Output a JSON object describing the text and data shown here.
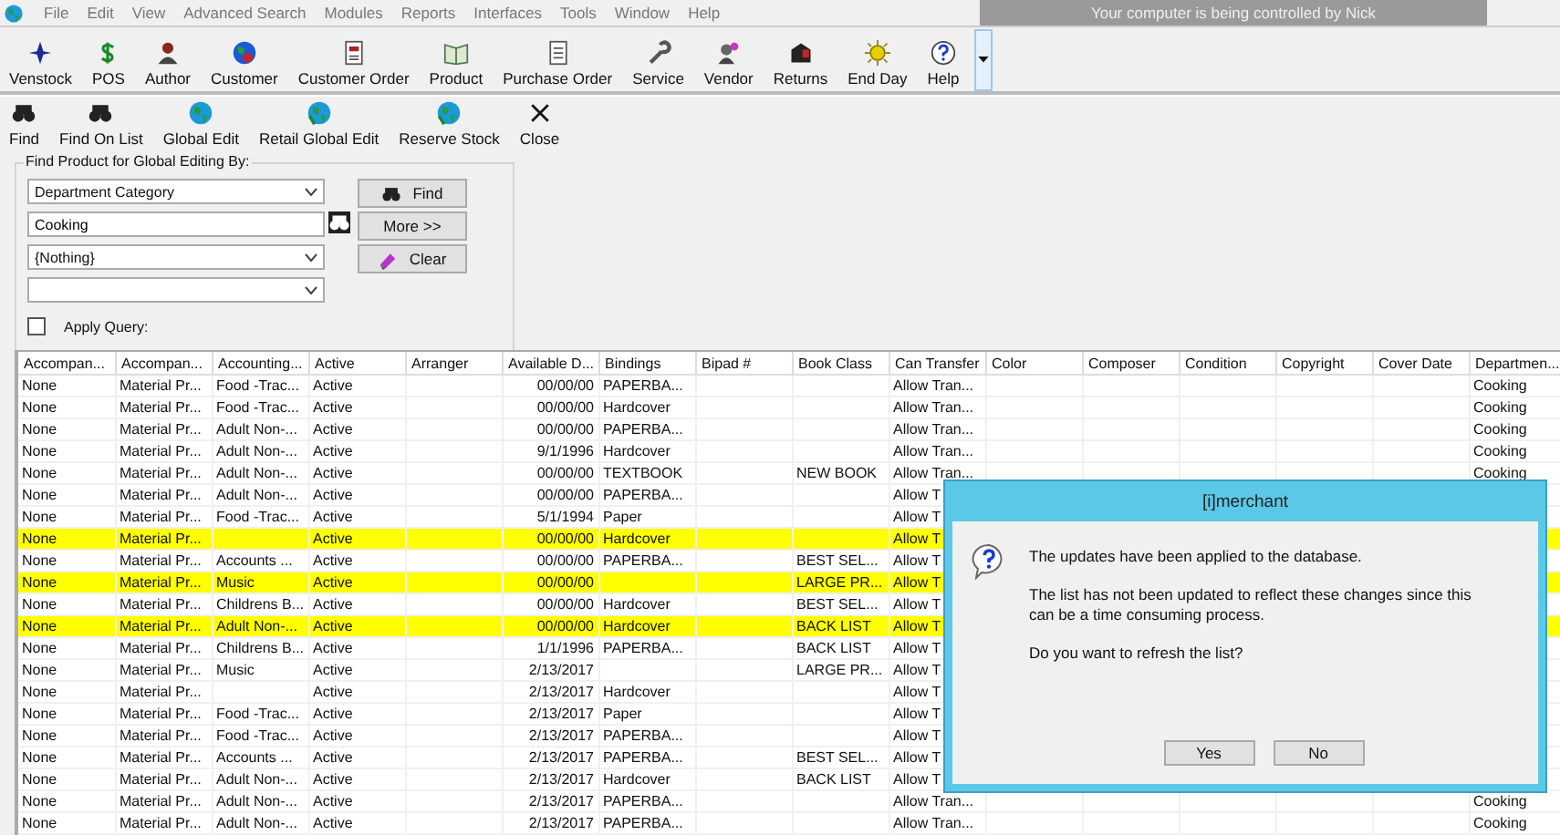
{
  "menu": [
    "File",
    "Edit",
    "View",
    "Advanced Search",
    "Modules",
    "Reports",
    "Interfaces",
    "Tools",
    "Window",
    "Help"
  ],
  "banner": {
    "text": "Your computer is being controlled by Nick"
  },
  "main_toolbar": [
    "Venstock",
    "POS",
    "Author",
    "Customer",
    "Customer Order",
    "Product",
    "Purchase Order",
    "Service",
    "Vendor",
    "Returns",
    "End Day",
    "Help"
  ],
  "sub_toolbar": [
    "Find",
    "Find On List",
    "Global Edit",
    "Retail Global Edit",
    "Reserve Stock",
    "Close"
  ],
  "find_panel": {
    "title": "Find Product for Global Editing By:",
    "field_1": "Department Category",
    "search_value": "Cooking",
    "field_2": "{Nothing}",
    "apply_query": {
      "label": "Apply Query:",
      "checked": false
    },
    "buttons": [
      "Find",
      "More >>",
      "Clear"
    ]
  },
  "table": {
    "columns": [
      "Accompan...",
      "Accompan...",
      "Accounting...",
      "Active",
      "Arranger",
      "Available D...",
      "Bindings",
      "Bipad #",
      "Book Class",
      "Can Transfer",
      "Color",
      "Composer",
      "Condition",
      "Copyright",
      "Cover Date",
      "Departmen..."
    ],
    "rows": [
      {
        "highlighted": false,
        "cells": {
          "column_1": "None",
          "column_2": "Material Pr...",
          "column_3": "Food -Trac...",
          "column_4": "Active",
          "column_6": "00/00/00",
          "column_7": "PAPERBA...",
          "column_10": "Allow Tran...",
          "column_16": "Cooking"
        }
      },
      {
        "highlighted": false,
        "cells": {
          "column_1": "None",
          "column_2": "Material Pr...",
          "column_3": "Food -Trac...",
          "column_4": "Active",
          "column_6": "00/00/00",
          "column_7": "Hardcover",
          "column_10": "Allow Tran...",
          "column_16": "Cooking"
        }
      },
      {
        "highlighted": false,
        "cells": {
          "column_1": "None",
          "column_2": "Material Pr...",
          "column_3": "Adult Non-...",
          "column_4": "Active",
          "column_6": "00/00/00",
          "column_7": "PAPERBA...",
          "column_10": "Allow Tran...",
          "column_16": "Cooking"
        }
      },
      {
        "highlighted": false,
        "cells": {
          "column_1": "None",
          "column_2": "Material Pr...",
          "column_3": "Adult Non-...",
          "column_4": "Active",
          "column_6": "9/1/1996",
          "column_7": "Hardcover",
          "column_10": "Allow Tran...",
          "column_16": "Cooking"
        }
      },
      {
        "highlighted": false,
        "cells": {
          "column_1": "None",
          "column_2": "Material Pr...",
          "column_3": "Adult Non-...",
          "column_4": "Active",
          "column_6": "00/00/00",
          "column_7": "TEXTBOOK",
          "column_9": "NEW BOOK",
          "column_10": "Allow Tran...",
          "column_16": "Cooking"
        }
      },
      {
        "highlighted": false,
        "cells": {
          "column_1": "None",
          "column_2": "Material Pr...",
          "column_3": "Adult Non-...",
          "column_4": "Active",
          "column_6": "00/00/00",
          "column_7": "PAPERBA...",
          "column_10": "Allow T"
        }
      },
      {
        "highlighted": false,
        "cells": {
          "column_1": "None",
          "column_2": "Material Pr...",
          "column_3": "Food -Trac...",
          "column_4": "Active",
          "column_6": "5/1/1994",
          "column_7": "Paper",
          "column_10": "Allow T"
        }
      },
      {
        "highlighted": true,
        "cells": {
          "column_1": "None",
          "column_2": "Material Pr...",
          "column_4": "Active",
          "column_6": "00/00/00",
          "column_7": "Hardcover",
          "column_10": "Allow T"
        }
      },
      {
        "highlighted": false,
        "cells": {
          "column_1": "None",
          "column_2": "Material Pr...",
          "column_3": "Accounts ...",
          "column_4": "Active",
          "column_6": "00/00/00",
          "column_7": "PAPERBA...",
          "column_9": "BEST SEL...",
          "column_10": "Allow T"
        }
      },
      {
        "highlighted": true,
        "cells": {
          "column_1": "None",
          "column_2": "Material Pr...",
          "column_3": "Music",
          "column_4": "Active",
          "column_6": "00/00/00",
          "column_9": "LARGE PR...",
          "column_10": "Allow T"
        }
      },
      {
        "highlighted": false,
        "cells": {
          "column_1": "None",
          "column_2": "Material Pr...",
          "column_3": "Childrens B...",
          "column_4": "Active",
          "column_6": "00/00/00",
          "column_7": "Hardcover",
          "column_9": "BEST SEL...",
          "column_10": "Allow T"
        }
      },
      {
        "highlighted": true,
        "cells": {
          "column_1": "None",
          "column_2": "Material Pr...",
          "column_3": "Adult Non-...",
          "column_4": "Active",
          "column_6": "00/00/00",
          "column_7": "Hardcover",
          "column_9": "BACK LIST",
          "column_10": "Allow T"
        }
      },
      {
        "highlighted": false,
        "cells": {
          "column_1": "None",
          "column_2": "Material Pr...",
          "column_3": "Childrens B...",
          "column_4": "Active",
          "column_6": "1/1/1996",
          "column_7": "PAPERBA...",
          "column_9": "BACK LIST",
          "column_10": "Allow T"
        }
      },
      {
        "highlighted": false,
        "cells": {
          "column_1": "None",
          "column_2": "Material Pr...",
          "column_3": "Music",
          "column_4": "Active",
          "column_6": "2/13/2017",
          "column_9": "LARGE PR...",
          "column_10": "Allow T"
        }
      },
      {
        "highlighted": false,
        "cells": {
          "column_1": "None",
          "column_2": "Material Pr...",
          "column_4": "Active",
          "column_6": "2/13/2017",
          "column_7": "Hardcover",
          "column_10": "Allow T"
        }
      },
      {
        "highlighted": false,
        "cells": {
          "column_1": "None",
          "column_2": "Material Pr...",
          "column_3": "Food -Trac...",
          "column_4": "Active",
          "column_6": "2/13/2017",
          "column_7": "Paper",
          "column_10": "Allow T"
        }
      },
      {
        "highlighted": false,
        "cells": {
          "column_1": "None",
          "column_2": "Material Pr...",
          "column_3": "Food -Trac...",
          "column_4": "Active",
          "column_6": "2/13/2017",
          "column_7": "PAPERBA...",
          "column_10": "Allow T"
        }
      },
      {
        "highlighted": false,
        "cells": {
          "column_1": "None",
          "column_2": "Material Pr...",
          "column_3": "Accounts ...",
          "column_4": "Active",
          "column_6": "2/13/2017",
          "column_7": "PAPERBA...",
          "column_9": "BEST SEL...",
          "column_10": "Allow T"
        }
      },
      {
        "highlighted": false,
        "cells": {
          "column_1": "None",
          "column_2": "Material Pr...",
          "column_3": "Adult Non-...",
          "column_4": "Active",
          "column_6": "2/13/2017",
          "column_7": "Hardcover",
          "column_9": "BACK LIST",
          "column_10": "Allow T"
        }
      },
      {
        "highlighted": false,
        "cells": {
          "column_1": "None",
          "column_2": "Material Pr...",
          "column_3": "Adult Non-...",
          "column_4": "Active",
          "column_6": "2/13/2017",
          "column_7": "PAPERBA...",
          "column_10": "Allow Tran...",
          "column_16": "Cooking"
        }
      },
      {
        "highlighted": false,
        "cells": {
          "column_1": "None",
          "column_2": "Material Pr...",
          "column_3": "Adult Non-...",
          "column_4": "Active",
          "column_6": "2/13/2017",
          "column_7": "PAPERBA...",
          "column_10": "Allow Tran...",
          "column_16": "Cooking"
        }
      }
    ]
  },
  "dialog": {
    "title": "[i]merchant",
    "paragraphs": [
      "The updates have been applied to the database.",
      "The list has not been updated to reflect these changes since this can be a time consuming process.",
      "Do you want to refresh the list?"
    ],
    "buttons": [
      "Yes",
      "No"
    ]
  }
}
